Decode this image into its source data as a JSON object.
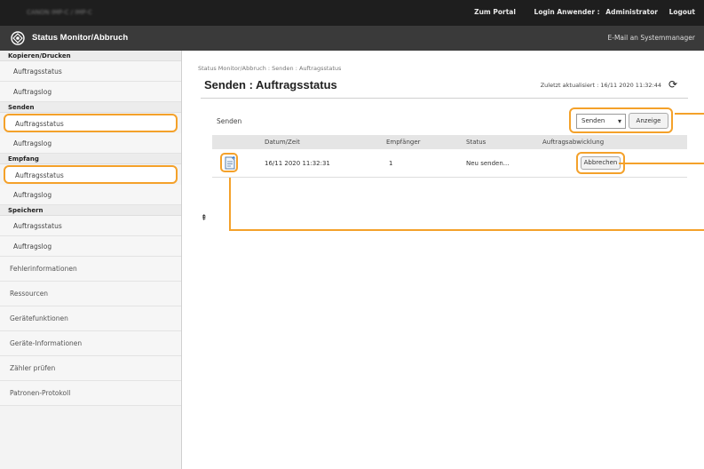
{
  "topbar": {
    "device_name": "CANON   IMP-C / IMP-C",
    "portal_link": "Zum Portal",
    "login_label": "Login Anwender :",
    "user": "Administrator",
    "logout": "Logout"
  },
  "titlebar": {
    "title": "Status Monitor/Abbruch",
    "mail_link": "E-Mail an Systemmanager"
  },
  "sidebar": {
    "sections": [
      {
        "title": "Kopieren/Drucken",
        "items": [
          "Auftragsstatus",
          "Auftragslog"
        ]
      },
      {
        "title": "Senden",
        "items": [
          "Auftragsstatus",
          "Auftragslog"
        ]
      },
      {
        "title": "Empfang",
        "items": [
          "Auftragsstatus",
          "Auftragslog"
        ]
      },
      {
        "title": "Speichern",
        "items": [
          "Auftragsstatus",
          "Auftragslog"
        ]
      }
    ],
    "other_items": [
      "Fehlerinformationen",
      "Ressourcen",
      "Gerätefunktionen",
      "Geräte-Informationen",
      "Zähler prüfen",
      "Patronen-Protokoll"
    ]
  },
  "main": {
    "breadcrumb": "Status Monitor/Abbruch : Senden : Auftragsstatus",
    "title": "Senden : Auftragsstatus",
    "last_updated": "Zuletzt aktualisiert : 16/11 2020 11:32:44",
    "section_label": "Senden",
    "filter_selected": "Senden",
    "show_button": "Anzeige",
    "columns": [
      "Datum/Zeit",
      "Empfänger",
      "Status",
      "Auftragsabwicklung"
    ],
    "jobs": [
      {
        "datetime": "16/11 2020 11:32:31",
        "recipients": "1",
        "status": "Neu senden...",
        "action": "Abbrechen"
      }
    ]
  },
  "colors": {
    "accent": "#f4a12a",
    "topbar": "#1e1e1e",
    "titlebar": "#3a3a3a"
  }
}
